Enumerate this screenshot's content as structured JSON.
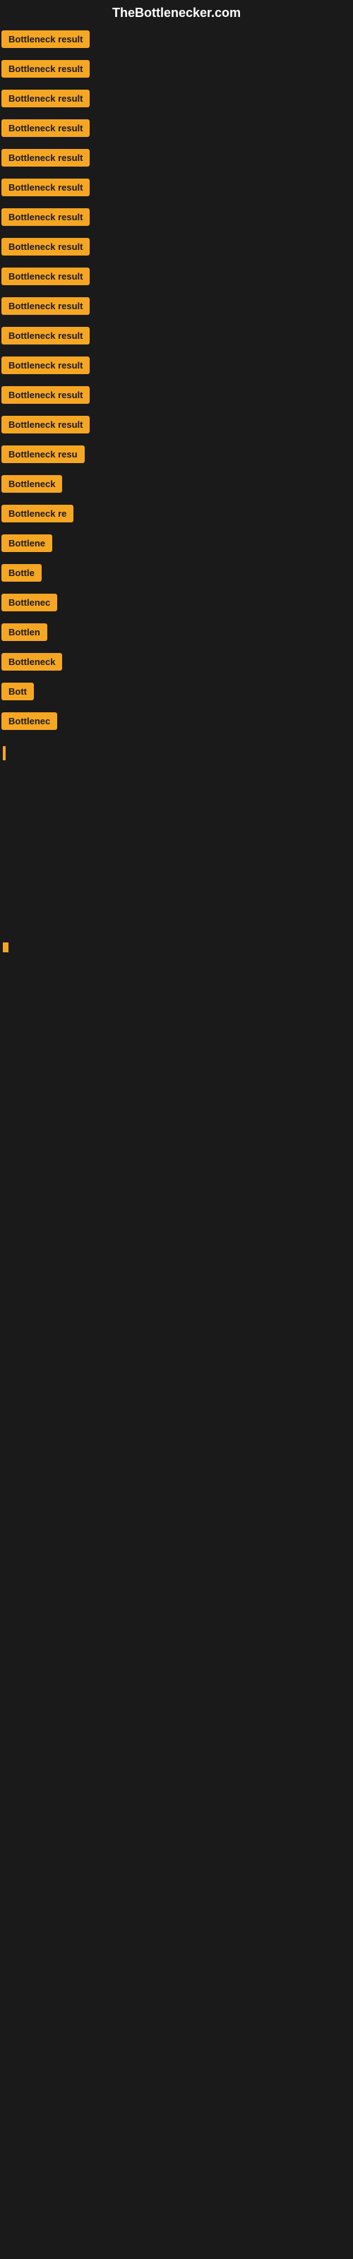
{
  "site": {
    "title": "TheBottlenecker.com"
  },
  "items": [
    {
      "id": 1,
      "label": "Bottleneck result",
      "width": 130
    },
    {
      "id": 2,
      "label": "Bottleneck result",
      "width": 130
    },
    {
      "id": 3,
      "label": "Bottleneck result",
      "width": 130
    },
    {
      "id": 4,
      "label": "Bottleneck result",
      "width": 130
    },
    {
      "id": 5,
      "label": "Bottleneck result",
      "width": 130
    },
    {
      "id": 6,
      "label": "Bottleneck result",
      "width": 130
    },
    {
      "id": 7,
      "label": "Bottleneck result",
      "width": 130
    },
    {
      "id": 8,
      "label": "Bottleneck result",
      "width": 130
    },
    {
      "id": 9,
      "label": "Bottleneck result",
      "width": 130
    },
    {
      "id": 10,
      "label": "Bottleneck result",
      "width": 130
    },
    {
      "id": 11,
      "label": "Bottleneck result",
      "width": 130
    },
    {
      "id": 12,
      "label": "Bottleneck result",
      "width": 130
    },
    {
      "id": 13,
      "label": "Bottleneck result",
      "width": 130
    },
    {
      "id": 14,
      "label": "Bottleneck result",
      "width": 130
    },
    {
      "id": 15,
      "label": "Bottleneck resu",
      "width": 118
    },
    {
      "id": 16,
      "label": "Bottleneck",
      "width": 80
    },
    {
      "id": 17,
      "label": "Bottleneck re",
      "width": 100
    },
    {
      "id": 18,
      "label": "Bottlene",
      "width": 72
    },
    {
      "id": 19,
      "label": "Bottle",
      "width": 56
    },
    {
      "id": 20,
      "label": "Bottlenec",
      "width": 76
    },
    {
      "id": 21,
      "label": "Bottlen",
      "width": 64
    },
    {
      "id": 22,
      "label": "Bottleneck",
      "width": 80
    },
    {
      "id": 23,
      "label": "Bott",
      "width": 42
    },
    {
      "id": 24,
      "label": "Bottlenec",
      "width": 76
    }
  ],
  "colors": {
    "badge_bg": "#f5a623",
    "badge_text": "#1a1a1a",
    "background": "#1a1a1a",
    "title_text": "#ffffff"
  }
}
